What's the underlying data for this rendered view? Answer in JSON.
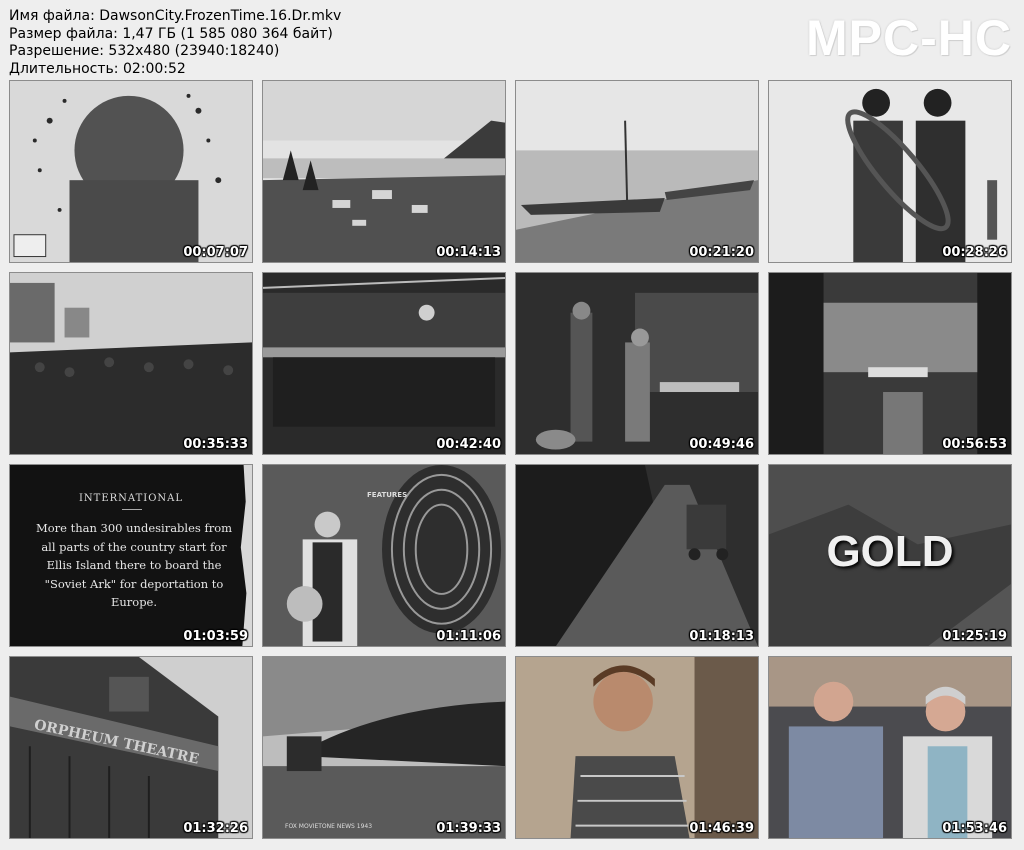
{
  "file_info": {
    "name_line": "Имя файла: DawsonCity.FrozenTime.16.Dr.mkv",
    "size_line": "Размер файла: 1,47 ГБ (1 585 080 364 байт)",
    "resolution_line": "Разрешение: 532x480 (23940:18240)",
    "duration_line": "Длительность: 02:00:52"
  },
  "logo": "MPC-HC",
  "thumbnails": [
    {
      "time": "00:07:07"
    },
    {
      "time": "00:14:13"
    },
    {
      "time": "00:21:20"
    },
    {
      "time": "00:28:26"
    },
    {
      "time": "00:35:33"
    },
    {
      "time": "00:42:40"
    },
    {
      "time": "00:49:46"
    },
    {
      "time": "00:56:53"
    },
    {
      "time": "01:03:59",
      "card_title": "INTERNATIONAL",
      "card_text": "More than 300 undesirables from all parts of the country start for Ellis Island there to board the \"Soviet Ark\" for deportation to Europe."
    },
    {
      "time": "01:11:06",
      "caption": "FEATURES"
    },
    {
      "time": "01:18:13"
    },
    {
      "time": "01:25:19",
      "title_word": "GOLD"
    },
    {
      "time": "01:32:26",
      "sign": "ORPHEUM THEATRE"
    },
    {
      "time": "01:39:33",
      "caption": "FOX MOVIETONE NEWS 1943"
    },
    {
      "time": "01:46:39"
    },
    {
      "time": "01:53:46"
    }
  ]
}
